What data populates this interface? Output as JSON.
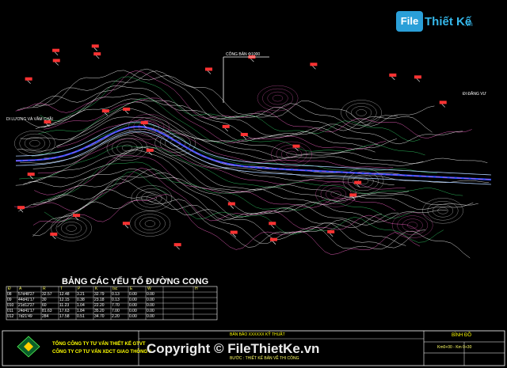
{
  "watermark": {
    "logo_badge": "File",
    "logo_name": "Thiết Kế",
    "logo_domain": ".vn",
    "copyright": "Copyright © FileThietKe.vn"
  },
  "map": {
    "label_left": "DI LƯƠNG VÀ VẦM CHẦI",
    "label_right": "ĐI ĐẰNG VƯ",
    "label_callout": "CÔNG BẢN Φ1000"
  },
  "curve_table": {
    "title": "BẢNG CÁC YẾU TỐ ĐƯỜNG CONG",
    "headers": [
      "Đ",
      "A",
      "R",
      "T",
      "P",
      "K",
      "Isc",
      "E",
      "W",
      "",
      "H"
    ],
    "rows": [
      [
        "08",
        "57d48'27",
        "32.57",
        "12.48",
        "3.21",
        "32.79",
        "0.13",
        "0.00",
        "0.00"
      ],
      [
        "09",
        "44d41'17",
        "30",
        "12.15",
        "0.38",
        "23.18",
        "0.13",
        "0.00",
        "0.00"
      ],
      [
        "010",
        "21d12'27",
        "60",
        "11.23",
        "1.04",
        "22.20",
        "7.70",
        "0.00",
        "0.00"
      ],
      [
        "011",
        "24d41'17",
        "81.63",
        "17.63",
        "1.84",
        "35.20",
        "7.00",
        "0.00",
        "0.00"
      ],
      [
        "012",
        "7d21'49",
        "284",
        "17.58",
        "0.51",
        "34.70",
        "2.20",
        "0.00",
        "0.00"
      ]
    ]
  },
  "title_block": {
    "left_line1": "TỔNG CÔNG TY TƯ VẤN THIẾT KẾ GTVT",
    "left_line2": "CÔNG TY CP TƯ VẤN XDCT GIAO THÔNG 2",
    "center_line1": "BẢN BẢO XXXXXX KỸ THUẬT",
    "center_line2": "BƯỚC : THIẾT KẾ BẢN VẼ THI CÔNG",
    "right_title": "BÌNH ĐỒ",
    "right_sub": "Km0+00 - Km 0+30"
  },
  "colors": {
    "contour_main": "#ffffff",
    "contour_pink": "#ff66cc",
    "contour_green": "#33cc66",
    "road_blue": "#3355ff",
    "road_edge": "#aaccff",
    "elev_red": "#ff3333",
    "table_line": "#ffffff",
    "title_yellow": "#ffff00"
  }
}
